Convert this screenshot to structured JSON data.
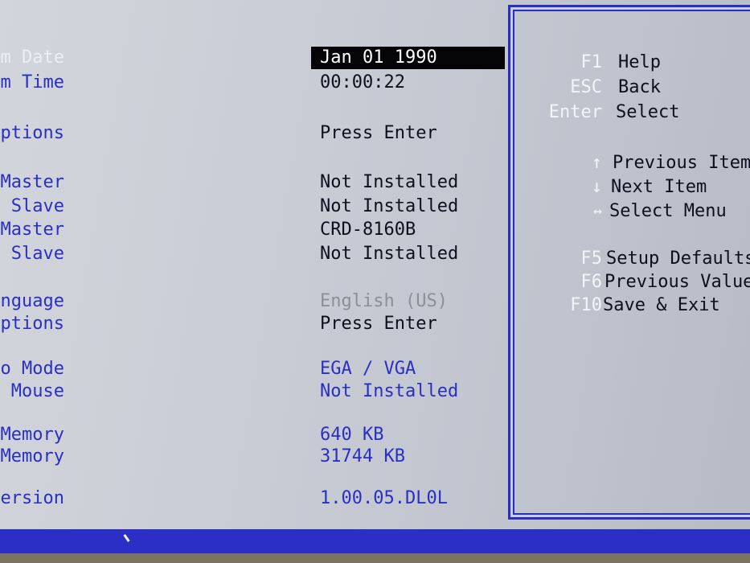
{
  "main": {
    "rows": [
      {
        "label": "System Date",
        "value": "Jan 01 1990"
      },
      {
        "label": "System Time",
        "value": "00:00:22"
      },
      {
        "label": "Floppy Options",
        "value": "Press Enter"
      },
      {
        "label": "Primary IDE Master",
        "value": "Not Installed"
      },
      {
        "label": "Primary IDE Slave",
        "value": "Not Installed"
      },
      {
        "label": "Secondary IDE Master",
        "value": "CRD-8160B"
      },
      {
        "label": "Secondary IDE Slave",
        "value": "Not Installed"
      },
      {
        "label": "Language",
        "value": "English  (US)"
      },
      {
        "label": "Boot Options",
        "value": "Press Enter"
      },
      {
        "label": "Video Mode",
        "value": "EGA / VGA"
      },
      {
        "label": "Mouse",
        "value": "Not Installed"
      },
      {
        "label": "Base Memory",
        "value": "640 KB"
      },
      {
        "label": "Extended Memory",
        "value": "31744 KB"
      },
      {
        "label": "BIOS Version",
        "value": "1.00.05.DL0L"
      }
    ]
  },
  "help": {
    "items": [
      {
        "key": "F1",
        "desc": "Help"
      },
      {
        "key": "ESC",
        "desc": "Back"
      },
      {
        "key": "Enter",
        "desc": "Select"
      },
      {
        "key": "↑",
        "desc": "Previous Item"
      },
      {
        "key": "↓",
        "desc": "Next Item"
      },
      {
        "key": "↔",
        "desc": "Select Menu"
      },
      {
        "key": "F5",
        "desc": "Setup Defaults"
      },
      {
        "key": "F6",
        "desc": "Previous Values"
      },
      {
        "key": "F10",
        "desc": "Save & Exit"
      }
    ]
  },
  "colors": {
    "label_blue": "#2a2fc4",
    "selection_bg": "#050507",
    "status_bar": "#2b2fc6",
    "background": "#c9ccd5"
  }
}
